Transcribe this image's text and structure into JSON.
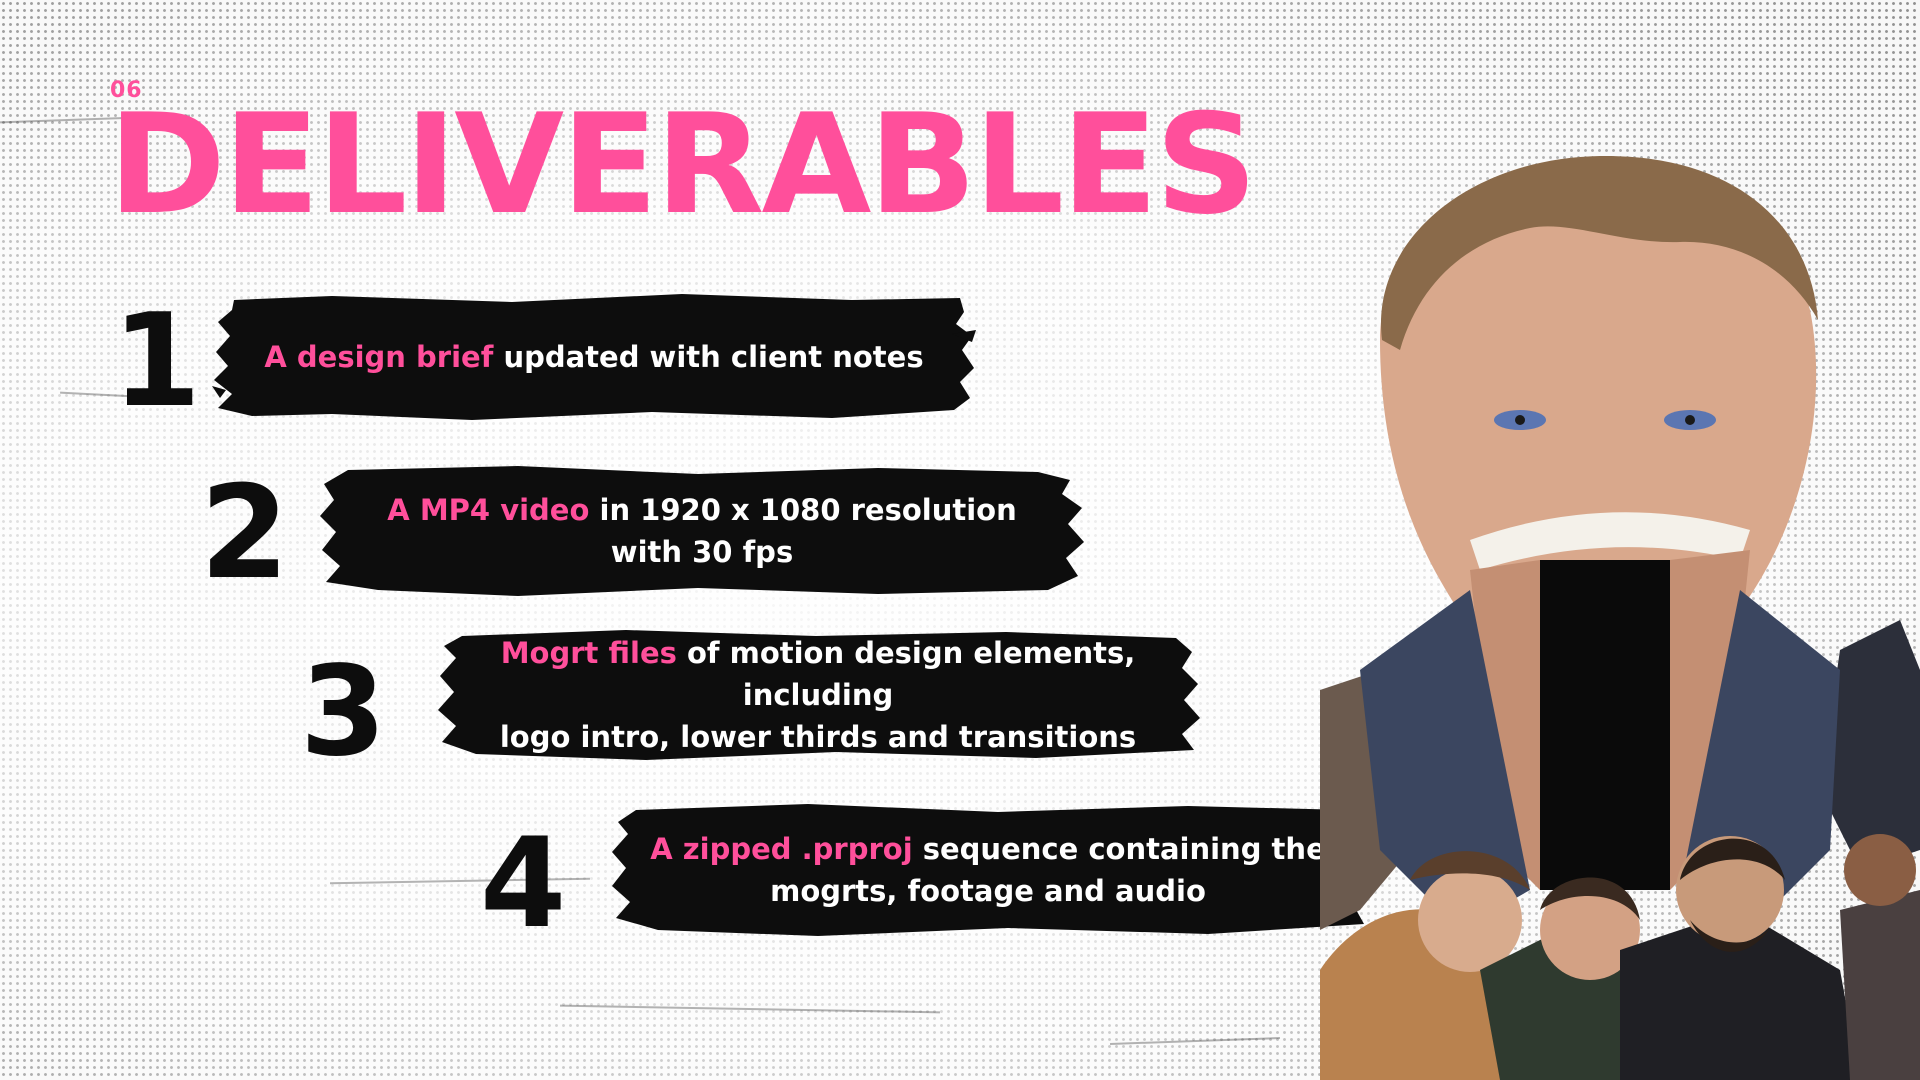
{
  "section_number": "06",
  "title": "DELIVERABLES",
  "colors": {
    "accent": "#ff4f9b",
    "brush": "#0d0d0d",
    "text_on_brush": "#ffffff",
    "number": "#0d0d0d"
  },
  "deliverables": [
    {
      "number": "1",
      "highlight": "A design brief",
      "text_line1": " updated with client notes",
      "text_line2": ""
    },
    {
      "number": "2",
      "highlight": "A MP4 video",
      "text_line1": " in 1920 x 1080 resolution",
      "text_line2": "with 30 fps"
    },
    {
      "number": "3",
      "highlight": "Mogrt files",
      "text_line1": " of motion design elements, including",
      "text_line2": "logo intro, lower thirds and transitions"
    },
    {
      "number": "4",
      "highlight": "A zipped .prproj",
      "text_line1": " sequence containing the",
      "text_line2": "mogrts, footage and audio"
    }
  ],
  "photo": {
    "icon": "character-collage-illustration"
  }
}
